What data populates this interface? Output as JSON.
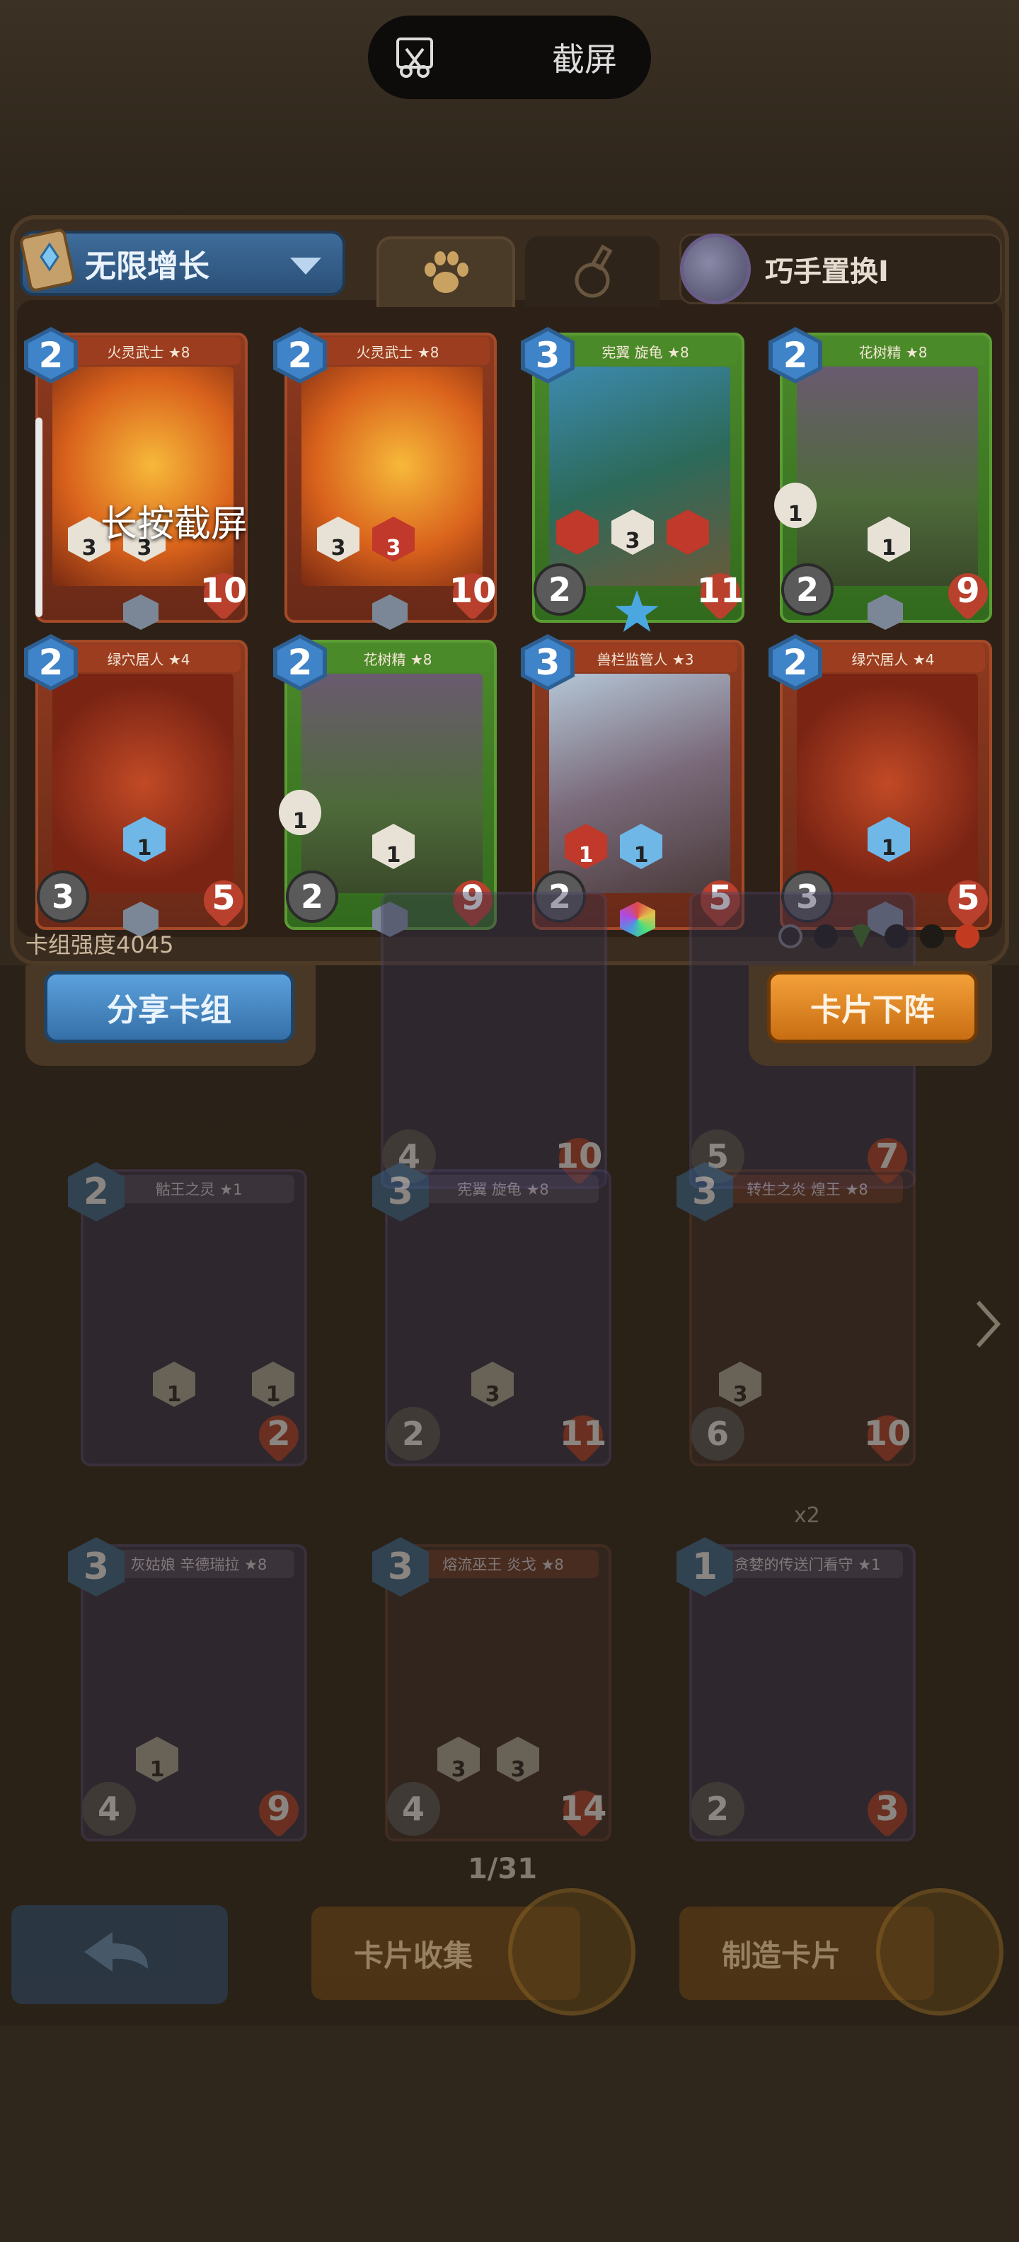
{
  "capture_overlay": {
    "label": "截屏",
    "hold_hint": "长按截屏"
  },
  "deck": {
    "mode_label": "无限增长",
    "skill_label": "巧手置换I",
    "strength_label": "卡组强度4045",
    "cards": [
      {
        "name": "火灵武士 ★8",
        "cost": "2",
        "atk": "",
        "hp": "10",
        "color": "red",
        "stats": [
          "3",
          "3"
        ]
      },
      {
        "name": "火灵武士 ★8",
        "cost": "2",
        "atk": "",
        "hp": "10",
        "color": "red",
        "stats": [
          "3",
          "3"
        ]
      },
      {
        "name": "宪翼 旋龟 ★8",
        "cost": "3",
        "atk": "2",
        "hp": "11",
        "color": "green",
        "stats": [
          "3"
        ]
      },
      {
        "name": "花树精 ★8",
        "cost": "2",
        "atk": "2",
        "hp": "9",
        "color": "green",
        "stats": [
          "1",
          "1"
        ]
      },
      {
        "name": "绿穴居人 ★4",
        "cost": "2",
        "atk": "3",
        "hp": "5",
        "color": "red",
        "stats": [
          "1"
        ]
      },
      {
        "name": "花树精 ★8",
        "cost": "2",
        "atk": "2",
        "hp": "9",
        "color": "green",
        "stats": [
          "1",
          "1"
        ]
      },
      {
        "name": "兽栏监管人 ★3",
        "cost": "3",
        "atk": "2",
        "hp": "5",
        "color": "red",
        "stats": [
          "1",
          "1"
        ]
      },
      {
        "name": "绿穴居人 ★4",
        "cost": "2",
        "atk": "3",
        "hp": "5",
        "color": "red",
        "stats": [
          "1"
        ]
      }
    ]
  },
  "actions": {
    "share_label": "分享卡组",
    "remove_label": "卡片下阵"
  },
  "collection": {
    "top_row": [
      {
        "atk": "4",
        "hp": "10"
      },
      {
        "atk": "5",
        "hp": "7"
      }
    ],
    "cards": [
      {
        "name": "骷王之灵 ★1",
        "cost": "2",
        "atk": "",
        "hp": "2",
        "stats": [
          "1",
          "1"
        ],
        "tone": "purple"
      },
      {
        "name": "宪翼 旋龟 ★8",
        "cost": "3",
        "atk": "2",
        "hp": "11",
        "stats": [
          "3"
        ],
        "tone": "purple"
      },
      {
        "name": "转生之炎 煌王 ★8",
        "cost": "3",
        "atk": "6",
        "hp": "10",
        "stats": [
          "3"
        ],
        "tone": "red"
      },
      {
        "name": "灰姑娘 辛德瑞拉 ★8",
        "cost": "3",
        "atk": "4",
        "hp": "9",
        "stats": [
          "1"
        ],
        "tone": "purple"
      },
      {
        "name": "熔流巫王 炎戈 ★8",
        "cost": "3",
        "atk": "4",
        "hp": "14",
        "stats": [
          "3",
          "3"
        ],
        "tone": "red"
      },
      {
        "name": "贪婪的传送门看守 ★1",
        "cost": "1",
        "atk": "2",
        "hp": "3",
        "stats": [],
        "tone": "purple"
      }
    ],
    "duplicate_badge": "x2",
    "page_indicator": "1/31"
  },
  "nav": {
    "collection_label": "卡片收集",
    "craft_label": "制造卡片"
  }
}
